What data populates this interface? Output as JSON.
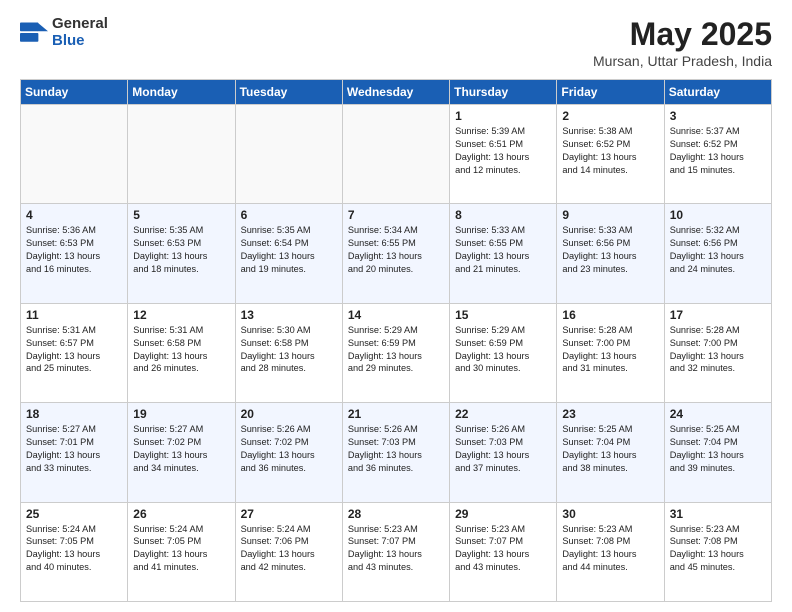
{
  "header": {
    "logo_general": "General",
    "logo_blue": "Blue",
    "month_title": "May 2025",
    "location": "Mursan, Uttar Pradesh, India"
  },
  "days_of_week": [
    "Sunday",
    "Monday",
    "Tuesday",
    "Wednesday",
    "Thursday",
    "Friday",
    "Saturday"
  ],
  "weeks": [
    [
      {
        "day": "",
        "content": ""
      },
      {
        "day": "",
        "content": ""
      },
      {
        "day": "",
        "content": ""
      },
      {
        "day": "",
        "content": ""
      },
      {
        "day": "1",
        "content": "Sunrise: 5:39 AM\nSunset: 6:51 PM\nDaylight: 13 hours\nand 12 minutes."
      },
      {
        "day": "2",
        "content": "Sunrise: 5:38 AM\nSunset: 6:52 PM\nDaylight: 13 hours\nand 14 minutes."
      },
      {
        "day": "3",
        "content": "Sunrise: 5:37 AM\nSunset: 6:52 PM\nDaylight: 13 hours\nand 15 minutes."
      }
    ],
    [
      {
        "day": "4",
        "content": "Sunrise: 5:36 AM\nSunset: 6:53 PM\nDaylight: 13 hours\nand 16 minutes."
      },
      {
        "day": "5",
        "content": "Sunrise: 5:35 AM\nSunset: 6:53 PM\nDaylight: 13 hours\nand 18 minutes."
      },
      {
        "day": "6",
        "content": "Sunrise: 5:35 AM\nSunset: 6:54 PM\nDaylight: 13 hours\nand 19 minutes."
      },
      {
        "day": "7",
        "content": "Sunrise: 5:34 AM\nSunset: 6:55 PM\nDaylight: 13 hours\nand 20 minutes."
      },
      {
        "day": "8",
        "content": "Sunrise: 5:33 AM\nSunset: 6:55 PM\nDaylight: 13 hours\nand 21 minutes."
      },
      {
        "day": "9",
        "content": "Sunrise: 5:33 AM\nSunset: 6:56 PM\nDaylight: 13 hours\nand 23 minutes."
      },
      {
        "day": "10",
        "content": "Sunrise: 5:32 AM\nSunset: 6:56 PM\nDaylight: 13 hours\nand 24 minutes."
      }
    ],
    [
      {
        "day": "11",
        "content": "Sunrise: 5:31 AM\nSunset: 6:57 PM\nDaylight: 13 hours\nand 25 minutes."
      },
      {
        "day": "12",
        "content": "Sunrise: 5:31 AM\nSunset: 6:58 PM\nDaylight: 13 hours\nand 26 minutes."
      },
      {
        "day": "13",
        "content": "Sunrise: 5:30 AM\nSunset: 6:58 PM\nDaylight: 13 hours\nand 28 minutes."
      },
      {
        "day": "14",
        "content": "Sunrise: 5:29 AM\nSunset: 6:59 PM\nDaylight: 13 hours\nand 29 minutes."
      },
      {
        "day": "15",
        "content": "Sunrise: 5:29 AM\nSunset: 6:59 PM\nDaylight: 13 hours\nand 30 minutes."
      },
      {
        "day": "16",
        "content": "Sunrise: 5:28 AM\nSunset: 7:00 PM\nDaylight: 13 hours\nand 31 minutes."
      },
      {
        "day": "17",
        "content": "Sunrise: 5:28 AM\nSunset: 7:00 PM\nDaylight: 13 hours\nand 32 minutes."
      }
    ],
    [
      {
        "day": "18",
        "content": "Sunrise: 5:27 AM\nSunset: 7:01 PM\nDaylight: 13 hours\nand 33 minutes."
      },
      {
        "day": "19",
        "content": "Sunrise: 5:27 AM\nSunset: 7:02 PM\nDaylight: 13 hours\nand 34 minutes."
      },
      {
        "day": "20",
        "content": "Sunrise: 5:26 AM\nSunset: 7:02 PM\nDaylight: 13 hours\nand 36 minutes."
      },
      {
        "day": "21",
        "content": "Sunrise: 5:26 AM\nSunset: 7:03 PM\nDaylight: 13 hours\nand 36 minutes."
      },
      {
        "day": "22",
        "content": "Sunrise: 5:26 AM\nSunset: 7:03 PM\nDaylight: 13 hours\nand 37 minutes."
      },
      {
        "day": "23",
        "content": "Sunrise: 5:25 AM\nSunset: 7:04 PM\nDaylight: 13 hours\nand 38 minutes."
      },
      {
        "day": "24",
        "content": "Sunrise: 5:25 AM\nSunset: 7:04 PM\nDaylight: 13 hours\nand 39 minutes."
      }
    ],
    [
      {
        "day": "25",
        "content": "Sunrise: 5:24 AM\nSunset: 7:05 PM\nDaylight: 13 hours\nand 40 minutes."
      },
      {
        "day": "26",
        "content": "Sunrise: 5:24 AM\nSunset: 7:05 PM\nDaylight: 13 hours\nand 41 minutes."
      },
      {
        "day": "27",
        "content": "Sunrise: 5:24 AM\nSunset: 7:06 PM\nDaylight: 13 hours\nand 42 minutes."
      },
      {
        "day": "28",
        "content": "Sunrise: 5:23 AM\nSunset: 7:07 PM\nDaylight: 13 hours\nand 43 minutes."
      },
      {
        "day": "29",
        "content": "Sunrise: 5:23 AM\nSunset: 7:07 PM\nDaylight: 13 hours\nand 43 minutes."
      },
      {
        "day": "30",
        "content": "Sunrise: 5:23 AM\nSunset: 7:08 PM\nDaylight: 13 hours\nand 44 minutes."
      },
      {
        "day": "31",
        "content": "Sunrise: 5:23 AM\nSunset: 7:08 PM\nDaylight: 13 hours\nand 45 minutes."
      }
    ]
  ]
}
